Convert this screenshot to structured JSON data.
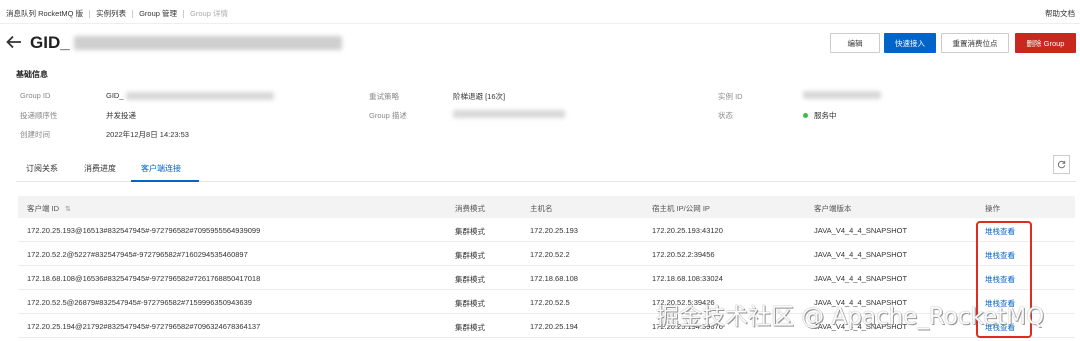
{
  "breadcrumb": {
    "items": [
      "消息队列 RocketMQ 版",
      "实例列表",
      "Group 管理"
    ],
    "current": "Group 详情"
  },
  "help_label": "帮助文档",
  "title_prefix": "GID_",
  "buttons": {
    "edit": "编辑",
    "quick_access": "快速接入",
    "reset_offset": "重置消费位点",
    "delete": "删除 Group"
  },
  "basic_info": {
    "title": "基础信息",
    "group_id_label": "Group ID",
    "group_id_value": "GID_",
    "retry_label": "重试策略",
    "retry_value": "阶梯退避 [16次]",
    "instance_label": "实例 ID",
    "delivery_label": "投递顺序性",
    "delivery_value": "并发投递",
    "desc_label": "Group 描述",
    "status_label": "状态",
    "status_value": "服务中",
    "created_label": "创建时间",
    "created_value": "2022年12月8日 14:23:53"
  },
  "tabs": [
    "订阅关系",
    "消费进度",
    "客户端连接"
  ],
  "table": {
    "headers": [
      "客户端 ID",
      "消费模式",
      "主机名",
      "宿主机 IP/公网 IP",
      "客户端版本",
      "操作"
    ],
    "sort_icon": "⇅",
    "rows": [
      {
        "client_id": "172.20.25.193@16513#832547945#-972796582#7095955564939099",
        "mode": "集群模式",
        "host": "172.20.25.193",
        "ip": "172.20.25.193:43120",
        "version": "JAVA_V4_4_4_SNAPSHOT",
        "action": "堆栈查看"
      },
      {
        "client_id": "172.20.52.2@5227#832547945#-972796582#7160294535460897",
        "mode": "集群模式",
        "host": "172.20.52.2",
        "ip": "172.20.52.2:39456",
        "version": "JAVA_V4_4_4_SNAPSHOT",
        "action": "堆栈查看"
      },
      {
        "client_id": "172.18.68.108@16536#832547945#-972796582#7261768850417018",
        "mode": "集群模式",
        "host": "172.18.68.108",
        "ip": "172.18.68.108:33024",
        "version": "JAVA_V4_4_4_SNAPSHOT",
        "action": "堆栈查看"
      },
      {
        "client_id": "172.20.52.5@26879#832547945#-972796582#7159996350943639",
        "mode": "集群模式",
        "host": "172.20.52.5",
        "ip": "172.20.52.5:39426",
        "version": "JAVA_V4_4_4_SNAPSHOT",
        "action": "堆栈查看"
      },
      {
        "client_id": "172.20.25.194@21792#832547945#-972796582#7096324678364137",
        "mode": "集群模式",
        "host": "172.20.25.194",
        "ip": "172.20.25.194:39676",
        "version": "JAVA_V4_4_4_SNAPSHOT",
        "action": "堆栈查看"
      }
    ]
  },
  "watermark": "掘金技术社区 @ Apache_RocketMQ",
  "colors": {
    "primary": "#0064c8",
    "danger": "#c8281e",
    "status_ok": "#3dbd3d",
    "highlight": "#e02b20"
  }
}
